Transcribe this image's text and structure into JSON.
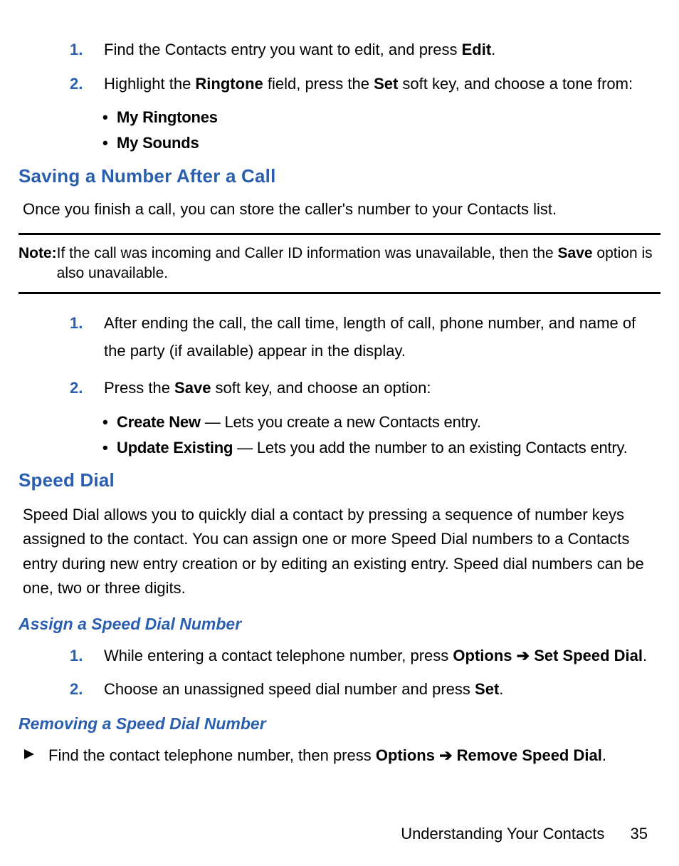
{
  "top_list": {
    "item1": {
      "num": "1.",
      "pre": "Find the Contacts entry you want to edit, and press ",
      "bold": "Edit",
      "post": "."
    },
    "item2": {
      "num": "2.",
      "pre": "Highlight the ",
      "b1": "Ringtone",
      "mid1": " field, press the ",
      "b2": "Set",
      "post": " soft key, and choose a tone from:"
    },
    "sub1": "My Ringtones",
    "sub2": "My Sounds"
  },
  "saving": {
    "heading": "Saving a Number After a Call",
    "para": "Once you finish a call, you can store the caller's number to your Contacts list.",
    "note_label": "Note:",
    "note_pre": "If the call was incoming and Caller ID information was unavailable, then the ",
    "note_bold": "Save",
    "note_post": " option is also unavailable.",
    "item1": {
      "num": "1.",
      "text": "After ending the call, the call time, length of call, phone number, and name of the party (if available) appear in the display."
    },
    "item2": {
      "num": "2.",
      "pre": "Press the ",
      "bold": "Save",
      "post": " soft key, and choose an option:"
    },
    "sub1": {
      "bold": "Create New",
      "rest": " — Lets you create a new Contacts entry."
    },
    "sub2": {
      "bold": "Update Existing",
      "rest": " — Lets you add the number to an existing Contacts entry."
    }
  },
  "speed": {
    "heading": "Speed Dial",
    "para": "Speed Dial allows you to quickly dial a contact by pressing a sequence of number keys assigned to the contact.  You can assign one or more Speed Dial numbers to a Contacts entry during new entry creation or by editing an existing entry. Speed dial numbers can be one, two or three digits.",
    "assign_heading": "Assign a Speed Dial Number",
    "assign_item1": {
      "num": "1.",
      "pre": "While entering a contact telephone number, press ",
      "b1": "Options",
      "arrow": " ➔ ",
      "b2": "Set Speed Dial",
      "post": "."
    },
    "assign_item2": {
      "num": "2.",
      "pre": "Choose an unassigned speed dial number and press ",
      "bold": "Set",
      "post": "."
    },
    "remove_heading": "Removing a Speed Dial Number",
    "remove_item": {
      "pre": "Find the contact telephone number, then press ",
      "b1": "Options",
      "arrow": " ➔ ",
      "b2": "Remove Speed Dial",
      "post": "."
    }
  },
  "footer": {
    "section": "Understanding Your Contacts",
    "page": "35"
  }
}
